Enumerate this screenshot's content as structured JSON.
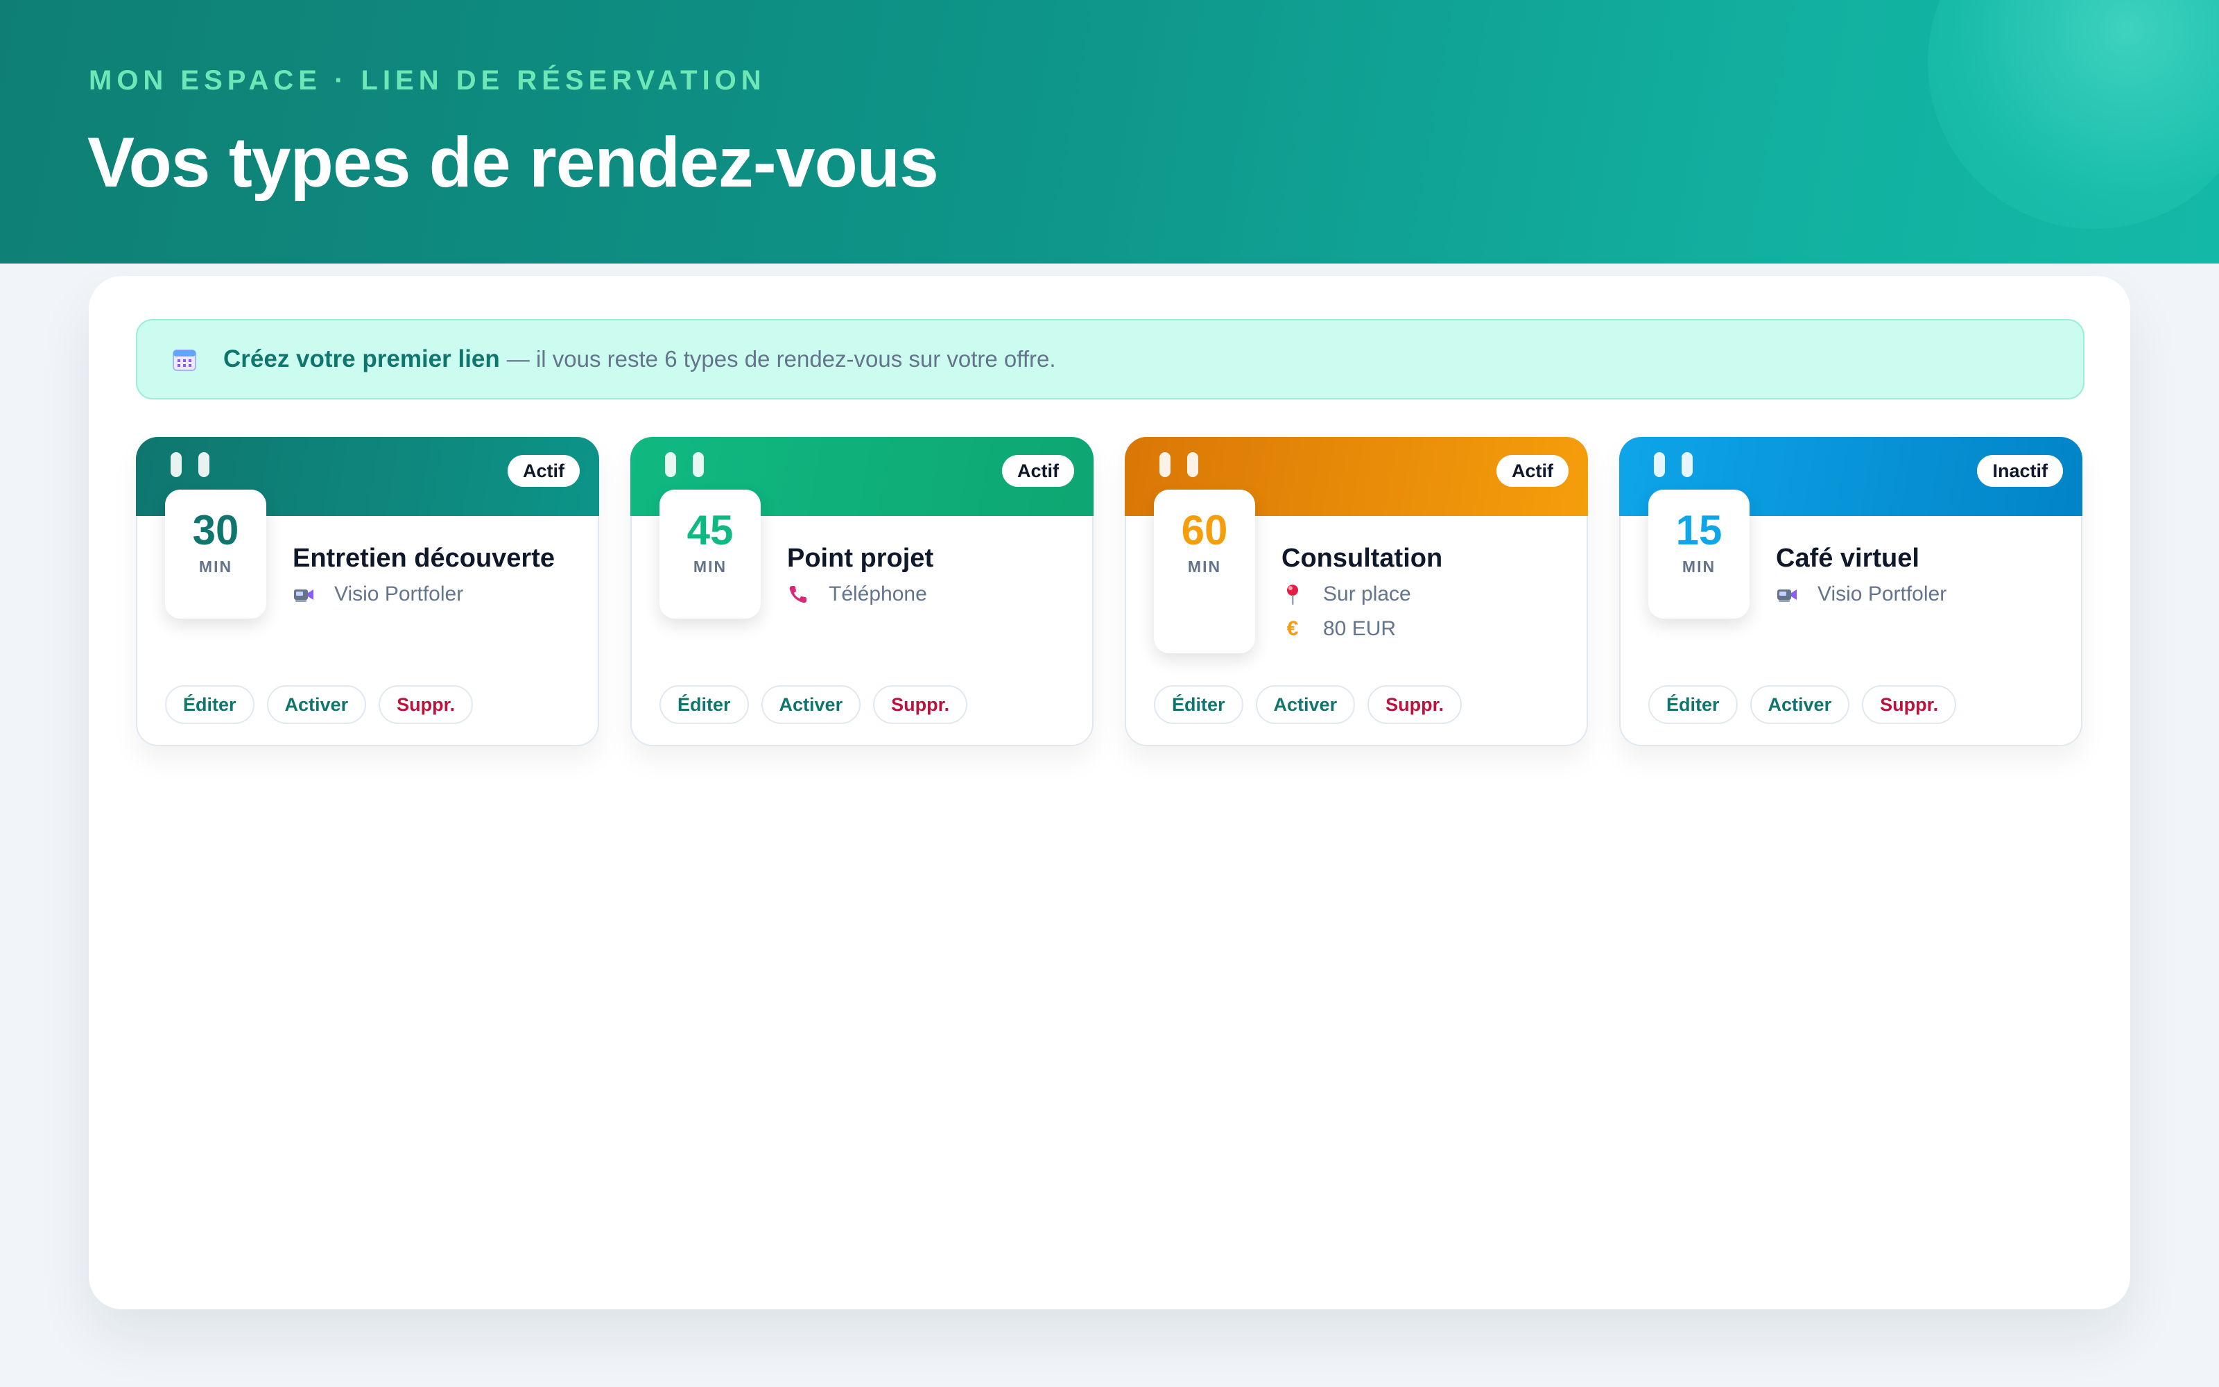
{
  "header": {
    "eyebrow": "MON ESPACE · LIEN DE RÉSERVATION",
    "title": "Vos types de rendez-vous"
  },
  "notice": {
    "icon": "calendar-icon",
    "strong": "Créez votre premier lien",
    "rest": "— il vous reste 6 types de rendez-vous sur votre offre."
  },
  "colors": {
    "brand": "#0f766e",
    "danger": "#be123c"
  },
  "cards": [
    {
      "duration": "30",
      "unit": "MIN",
      "title": "Entretien découverte",
      "status": "Actif",
      "accent": "#0f766e",
      "band_from": "#0f766e",
      "band_to": "#0d9488",
      "meta": [
        {
          "icon": "video-call-icon",
          "text": "Visio Portfoler"
        }
      ],
      "actions": {
        "edit": "Éditer",
        "toggle": "Activer",
        "delete": "Suppr."
      }
    },
    {
      "duration": "45",
      "unit": "MIN",
      "title": "Point projet",
      "status": "Actif",
      "accent": "#10b981",
      "band_from": "#10b981",
      "band_to": "#0ea672",
      "meta": [
        {
          "icon": "phone-icon",
          "text": "Téléphone"
        }
      ],
      "actions": {
        "edit": "Éditer",
        "toggle": "Activer",
        "delete": "Suppr."
      }
    },
    {
      "duration": "60",
      "unit": "MIN",
      "title": "Consultation",
      "status": "Actif",
      "accent": "#f59e0b",
      "band_from": "#d97706",
      "band_to": "#f59e0b",
      "meta": [
        {
          "icon": "location-pin-icon",
          "text": "Sur place"
        },
        {
          "icon": "euro-icon",
          "text": "80 EUR"
        }
      ],
      "actions": {
        "edit": "Éditer",
        "toggle": "Activer",
        "delete": "Suppr."
      }
    },
    {
      "duration": "15",
      "unit": "MIN",
      "title": "Café virtuel",
      "status": "Inactif",
      "accent": "#0ea5e9",
      "band_from": "#0ea5e9",
      "band_to": "#0284c7",
      "meta": [
        {
          "icon": "video-call-icon",
          "text": "Visio Portfoler"
        }
      ],
      "actions": {
        "edit": "Éditer",
        "toggle": "Activer",
        "delete": "Suppr."
      }
    }
  ]
}
